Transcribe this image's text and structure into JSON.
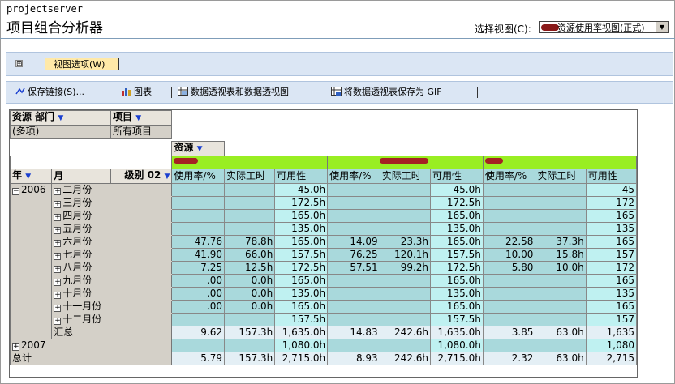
{
  "header": {
    "server": "projectserver",
    "title": "项目组合分析器",
    "view_label": "选择视图(C):",
    "view_value": "资源使用率视图(正式)"
  },
  "bar1": {
    "expand_glyph": "⊞",
    "view_options_label": "视图选项(W)"
  },
  "toolbar": {
    "save_link": "保存链接(S)...",
    "chart": "图表",
    "pivot_table_chart": "数据透视表和数据透视图",
    "save_gif": "将数据透视表保存为 GIF"
  },
  "pivot": {
    "filter": {
      "field1": "资源 部门",
      "field2": "项目",
      "value1": "(多项)",
      "value2": "所有项目"
    },
    "col_field": "资源",
    "row_fields": [
      "年",
      "月",
      "级别 02"
    ],
    "measures": [
      "使用率/%",
      "实际工时",
      "可用性"
    ],
    "year_2006": "2006",
    "year_2007": "2007",
    "subtotal_label": "汇总",
    "grand_total_label": "总计",
    "rows": [
      {
        "label": "二月份",
        "cells": [
          "",
          "",
          "45.0h",
          "",
          "",
          "45.0h",
          "",
          "",
          "45"
        ]
      },
      {
        "label": "三月份",
        "cells": [
          "",
          "",
          "172.5h",
          "",
          "",
          "172.5h",
          "",
          "",
          "172"
        ]
      },
      {
        "label": "四月份",
        "cells": [
          "",
          "",
          "165.0h",
          "",
          "",
          "165.0h",
          "",
          "",
          "165"
        ]
      },
      {
        "label": "五月份",
        "cells": [
          "",
          "",
          "135.0h",
          "",
          "",
          "135.0h",
          "",
          "",
          "135"
        ]
      },
      {
        "label": "六月份",
        "cells": [
          "47.76",
          "78.8h",
          "165.0h",
          "14.09",
          "23.3h",
          "165.0h",
          "22.58",
          "37.3h",
          "165"
        ]
      },
      {
        "label": "七月份",
        "cells": [
          "41.90",
          "66.0h",
          "157.5h",
          "76.25",
          "120.1h",
          "157.5h",
          "10.00",
          "15.8h",
          "157"
        ]
      },
      {
        "label": "八月份",
        "cells": [
          "7.25",
          "12.5h",
          "172.5h",
          "57.51",
          "99.2h",
          "172.5h",
          "5.80",
          "10.0h",
          "172"
        ]
      },
      {
        "label": "九月份",
        "cells": [
          ".00",
          "0.0h",
          "165.0h",
          "",
          "",
          "165.0h",
          "",
          "",
          "165"
        ]
      },
      {
        "label": "十月份",
        "cells": [
          ".00",
          "0.0h",
          "135.0h",
          "",
          "",
          "135.0h",
          "",
          "",
          "135"
        ]
      },
      {
        "label": "十一月份",
        "cells": [
          ".00",
          "0.0h",
          "165.0h",
          "",
          "",
          "165.0h",
          "",
          "",
          "165"
        ]
      },
      {
        "label": "十二月份",
        "cells": [
          "",
          "",
          "157.5h",
          "",
          "",
          "157.5h",
          "",
          "",
          "157"
        ]
      }
    ],
    "subtotal": [
      "9.62",
      "157.3h",
      "1,635.0h",
      "14.83",
      "242.6h",
      "1,635.0h",
      "3.85",
      "63.0h",
      "1,635"
    ],
    "y2007": [
      "",
      "",
      "1,080.0h",
      "",
      "",
      "1,080.0h",
      "",
      "",
      "1,080"
    ],
    "grand_total": [
      "5.79",
      "157.3h",
      "2,715.0h",
      "8.93",
      "242.6h",
      "2,715.0h",
      "2.32",
      "63.0h",
      "2,715"
    ]
  }
}
